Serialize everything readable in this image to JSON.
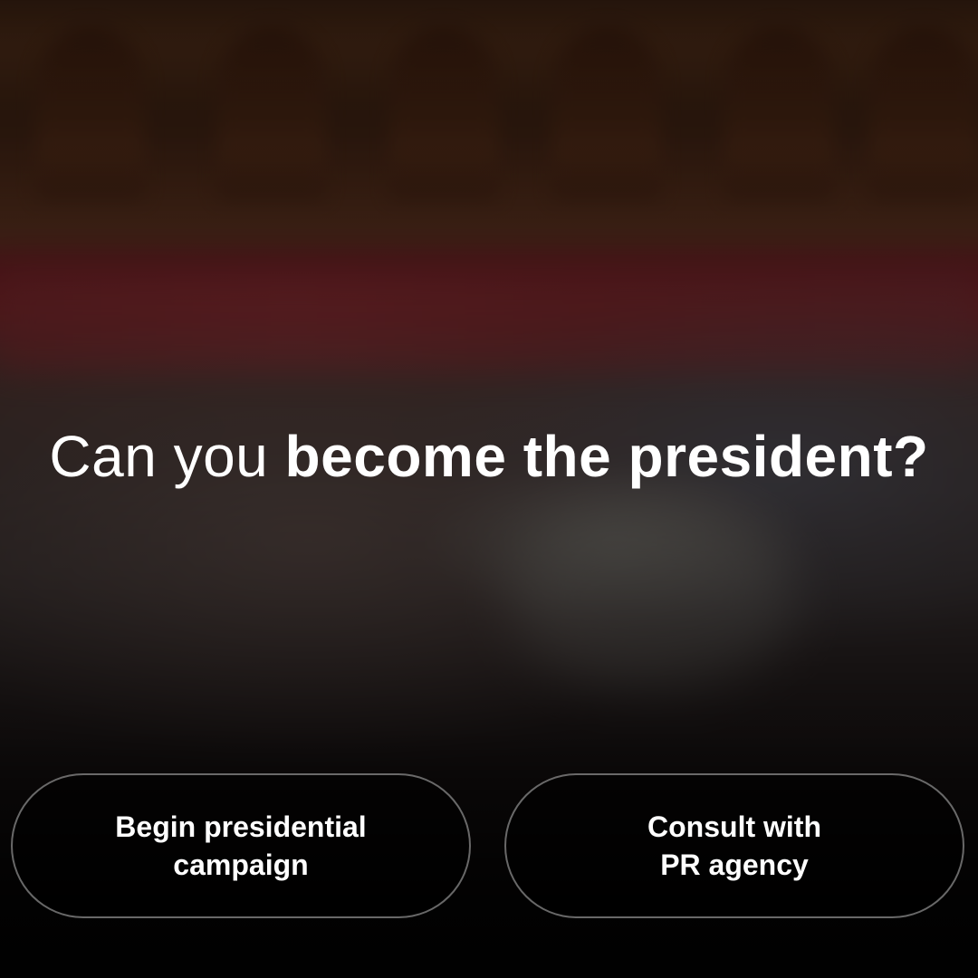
{
  "question": {
    "lead": "Can you ",
    "emphasis": "become the president?"
  },
  "choices": [
    {
      "label": "Begin presidential\ncampaign"
    },
    {
      "label": "Consult with\nPR agency"
    }
  ],
  "background": {
    "scene": "parliament-chamber-photo"
  }
}
